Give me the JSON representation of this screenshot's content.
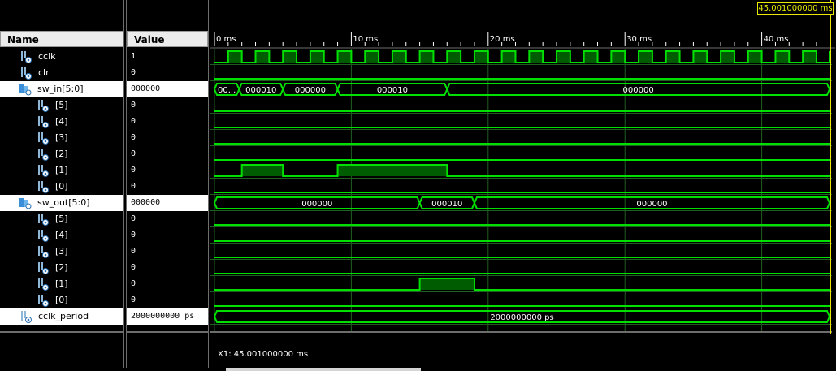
{
  "header": {
    "name_label": "Name",
    "value_label": "Value"
  },
  "time_axis": {
    "unit": "ms",
    "ticks": [
      {
        "t": 0,
        "label": "0 ms"
      },
      {
        "t": 10,
        "label": "10 ms"
      },
      {
        "t": 20,
        "label": "20 ms"
      },
      {
        "t": 30,
        "label": "30 ms"
      },
      {
        "t": 40,
        "label": "40 ms"
      }
    ]
  },
  "cursor": {
    "time": 45.001,
    "label": "45.001000000 ms",
    "readout": "X1: 45.001000000 ms"
  },
  "colors": {
    "wave": "#00e000",
    "wave_fill": "#005c00",
    "grid": "#1f5f1f",
    "cursor": "#e8e800",
    "label": "#ffffff",
    "bus_text": "#ffffff"
  },
  "signals": [
    {
      "name": "cclk",
      "value": "1",
      "type": "clock",
      "indent": 1,
      "period": 2,
      "start_high": false
    },
    {
      "name": "clr",
      "value": "0",
      "type": "bit",
      "indent": 1,
      "segments": [
        [
          0,
          45.5,
          0
        ]
      ]
    },
    {
      "name": "sw_in[5:0]",
      "value": "000000",
      "type": "bus",
      "indent": 0,
      "expandable": true,
      "selected": true,
      "segments": [
        [
          0,
          1.8,
          "00..."
        ],
        [
          1.8,
          5,
          "000010"
        ],
        [
          5,
          9,
          "000000"
        ],
        [
          9,
          17,
          "000010"
        ],
        [
          17,
          45.5,
          "000000"
        ]
      ]
    },
    {
      "name": "[5]",
      "value": "0",
      "type": "bit",
      "indent": 2,
      "segments": [
        [
          0,
          45.5,
          0
        ]
      ]
    },
    {
      "name": "[4]",
      "value": "0",
      "type": "bit",
      "indent": 2,
      "segments": [
        [
          0,
          45.5,
          0
        ]
      ]
    },
    {
      "name": "[3]",
      "value": "0",
      "type": "bit",
      "indent": 2,
      "segments": [
        [
          0,
          45.5,
          0
        ]
      ]
    },
    {
      "name": "[2]",
      "value": "0",
      "type": "bit",
      "indent": 2,
      "segments": [
        [
          0,
          45.5,
          0
        ]
      ]
    },
    {
      "name": "[1]",
      "value": "0",
      "type": "bit",
      "indent": 2,
      "segments": [
        [
          0,
          2,
          0
        ],
        [
          2,
          5,
          1
        ],
        [
          5,
          9,
          0
        ],
        [
          9,
          17,
          1
        ],
        [
          17,
          45.5,
          0
        ]
      ]
    },
    {
      "name": "[0]",
      "value": "0",
      "type": "bit",
      "indent": 2,
      "segments": [
        [
          0,
          45.5,
          0
        ]
      ]
    },
    {
      "name": "sw_out[5:0]",
      "value": "000000",
      "type": "bus",
      "indent": 0,
      "expandable": true,
      "selected": true,
      "segments": [
        [
          0,
          15,
          "000000"
        ],
        [
          15,
          19,
          "000010"
        ],
        [
          19,
          45.5,
          "000000"
        ]
      ]
    },
    {
      "name": "[5]",
      "value": "0",
      "type": "bit",
      "indent": 2,
      "segments": [
        [
          0,
          45.5,
          0
        ]
      ]
    },
    {
      "name": "[4]",
      "value": "0",
      "type": "bit",
      "indent": 2,
      "segments": [
        [
          0,
          45.5,
          0
        ]
      ]
    },
    {
      "name": "[3]",
      "value": "0",
      "type": "bit",
      "indent": 2,
      "segments": [
        [
          0,
          45.5,
          0
        ]
      ]
    },
    {
      "name": "[2]",
      "value": "0",
      "type": "bit",
      "indent": 2,
      "segments": [
        [
          0,
          45.5,
          0
        ]
      ]
    },
    {
      "name": "[1]",
      "value": "0",
      "type": "bit",
      "indent": 2,
      "segments": [
        [
          0,
          15,
          0
        ],
        [
          15,
          19,
          1
        ],
        [
          19,
          45.5,
          0
        ]
      ]
    },
    {
      "name": "[0]",
      "value": "0",
      "type": "bit",
      "indent": 2,
      "segments": [
        [
          0,
          45.5,
          0
        ]
      ]
    },
    {
      "name": "cclk_period",
      "value": "2000000000 ps",
      "type": "bus",
      "indent": 1,
      "selected": true,
      "segments": [
        [
          0,
          45.5,
          "2000000000 ps"
        ]
      ]
    }
  ]
}
